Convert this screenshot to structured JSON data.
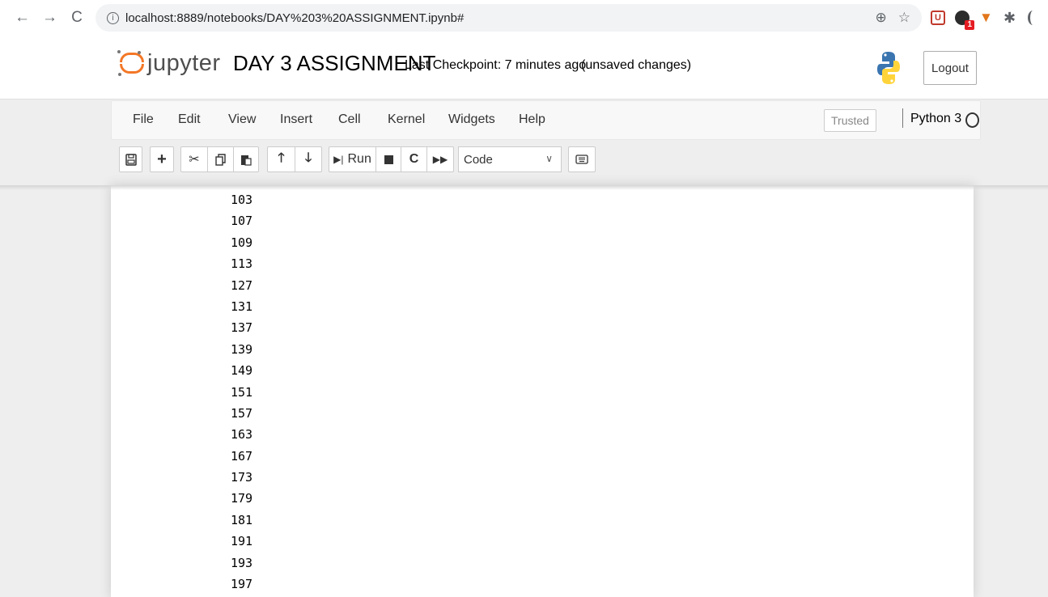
{
  "browser": {
    "url": "localhost:8889/notebooks/DAY%203%20ASSIGNMENT.ipynb#",
    "extension_badge": "1"
  },
  "header": {
    "logo_text": "jupyter",
    "notebook_name": "DAY 3 ASSIGNMENT",
    "checkpoint": "Last Checkpoint: 7 minutes ago",
    "autosave_status": "(unsaved changes)",
    "logout_label": "Logout"
  },
  "menubar": {
    "items": [
      "File",
      "Edit",
      "View",
      "Insert",
      "Cell",
      "Kernel",
      "Widgets",
      "Help"
    ],
    "trusted_label": "Trusted",
    "kernel_name": "Python 3"
  },
  "toolbar": {
    "run_label": "Run",
    "cell_type": "Code"
  },
  "output": {
    "lines": [
      "103",
      "107",
      "109",
      "113",
      "127",
      "131",
      "137",
      "139",
      "149",
      "151",
      "157",
      "163",
      "167",
      "173",
      "179",
      "181",
      "191",
      "193",
      "197"
    ]
  },
  "colors": {
    "jupyter_orange": "#f37726",
    "page_background": "#eeeeee",
    "menubar_background": "#f8f8f8"
  }
}
